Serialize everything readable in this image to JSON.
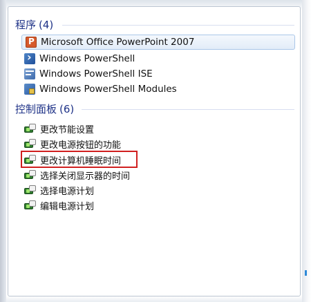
{
  "programs": {
    "header": "程序",
    "count": "(4)",
    "items": [
      {
        "label": "Microsoft Office PowerPoint 2007",
        "icon": "powerpoint-icon",
        "selected": true
      },
      {
        "label": "Windows PowerShell",
        "icon": "powershell-icon"
      },
      {
        "label": "Windows PowerShell ISE",
        "icon": "powershell-ise-icon"
      },
      {
        "label": "Windows PowerShell Modules",
        "icon": "powershell-modules-icon"
      }
    ]
  },
  "control_panel": {
    "header": "控制面板",
    "count": "(6)",
    "items": [
      {
        "label": "更改节能设置",
        "icon": "power-options-icon"
      },
      {
        "label": "更改电源按钮的功能",
        "icon": "power-options-icon"
      },
      {
        "label": "更改计算机睡眠时间",
        "icon": "power-options-icon",
        "highlighted": true
      },
      {
        "label": "选择关闭显示器的时间",
        "icon": "power-options-icon"
      },
      {
        "label": "选择电源计划",
        "icon": "power-options-icon"
      },
      {
        "label": "编辑电源计划",
        "icon": "power-options-icon"
      }
    ]
  },
  "colors": {
    "header_text": "#1e3287",
    "selection_border": "#aac6e8",
    "highlight_box": "#d01f1f"
  }
}
